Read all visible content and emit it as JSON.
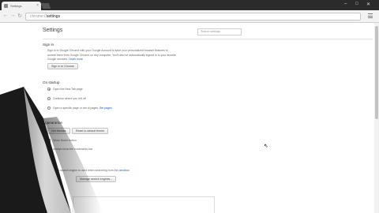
{
  "browser": {
    "tab_title": "Settings",
    "url_scheme": "chrome://",
    "url_path": "settings"
  },
  "settings": {
    "title": "Settings",
    "search_placeholder": "Search settings",
    "signin": {
      "heading": "Sign in",
      "line1": "Sign in to Google Chrome with your Google Account to save your personalized browser features to",
      "line2": "access them from Google Chrome on any computer. You'll also be automatically signed in to your favorite",
      "line3_prefix": "Google services.",
      "learn_more": "Learn more",
      "button": "Sign in to Chrome"
    },
    "startup": {
      "heading": "On startup",
      "options": [
        {
          "label": "Open the New Tab page",
          "selected": true
        },
        {
          "label": "Continue where you left off",
          "selected": false
        },
        {
          "label": "Open a specific page or set of pages.",
          "link": "Set pages",
          "selected": false
        }
      ]
    },
    "appearance": {
      "heading": "Appearance",
      "get_themes": "Get themes",
      "reset_theme": "Reset to default theme",
      "show_home": "Show Home button",
      "show_bookmarks": "Always show the bookmarks bar"
    },
    "search": {
      "heading": "Search",
      "line_prefix": "Set which search engine is used when searching from the",
      "omnibox_link": "omnibox",
      "manage_button": "Manage search engines..."
    }
  }
}
